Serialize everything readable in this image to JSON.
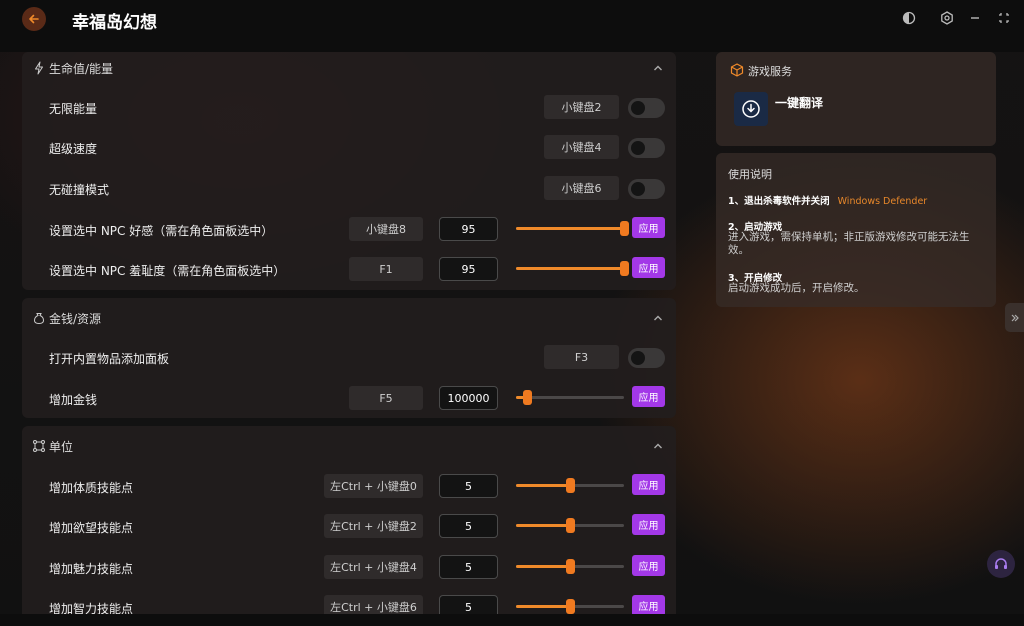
{
  "app": {
    "title": "幸福岛幻想"
  },
  "colors": {
    "accent": "#f08a2a",
    "apply": "#a338e8",
    "link": "#e7872a"
  },
  "icons": {
    "back": "arrow-left-icon",
    "theme": "theme-icon",
    "settings": "settings-icon",
    "minimize": "minimize-icon",
    "close": "close-icon"
  },
  "sections": {
    "life": {
      "title": "生命值/能量",
      "rows": [
        {
          "label": "无限能量",
          "hotkey": "小键盘2",
          "toggle": false
        },
        {
          "label": "超级速度",
          "hotkey": "小键盘4",
          "toggle": false
        },
        {
          "label": "无碰撞模式",
          "hotkey": "小键盘6",
          "toggle": false
        },
        {
          "label": "设置选中 NPC 好感（需在角色面板选中）",
          "hotkey": "小键盘8",
          "value": "95",
          "slider": 1.0,
          "apply": "应用"
        },
        {
          "label": "设置选中 NPC 羞耻度（需在角色面板选中）",
          "hotkey": "F1",
          "value": "95",
          "slider": 1.0,
          "apply": "应用"
        }
      ]
    },
    "money": {
      "title": "金钱/资源",
      "rows": [
        {
          "label": "打开内置物品添加面板",
          "hotkey": "F3",
          "toggle": false
        },
        {
          "label": "增加金钱",
          "hotkey": "F5",
          "value": "100000",
          "slider": 0.1,
          "apply": "应用"
        }
      ]
    },
    "unit": {
      "title": "单位",
      "rows": [
        {
          "label": "增加体质技能点",
          "hotkey": "左Ctrl + 小键盘0",
          "value": "5",
          "slider": 0.5,
          "apply": "应用"
        },
        {
          "label": "增加欲望技能点",
          "hotkey": "左Ctrl + 小键盘2",
          "value": "5",
          "slider": 0.5,
          "apply": "应用"
        },
        {
          "label": "增加魅力技能点",
          "hotkey": "左Ctrl + 小键盘4",
          "value": "5",
          "slider": 0.5,
          "apply": "应用"
        },
        {
          "label": "增加智力技能点",
          "hotkey": "左Ctrl + 小键盘6",
          "value": "5",
          "slider": 0.5,
          "apply": "应用"
        }
      ]
    }
  },
  "services": {
    "title": "游戏服务",
    "item_label": "一键翻译"
  },
  "help": {
    "title": "使用说明",
    "step1_title": "1、退出杀毒软件并关闭",
    "step1_link": "Windows Defender",
    "step2_title": "2、启动游戏",
    "step2_text": "进入游戏，需保持单机；非正版游戏修改可能无法生效。",
    "step3_title": "3、开启修改",
    "step3_text": "启动游戏成功后，开启修改。"
  }
}
